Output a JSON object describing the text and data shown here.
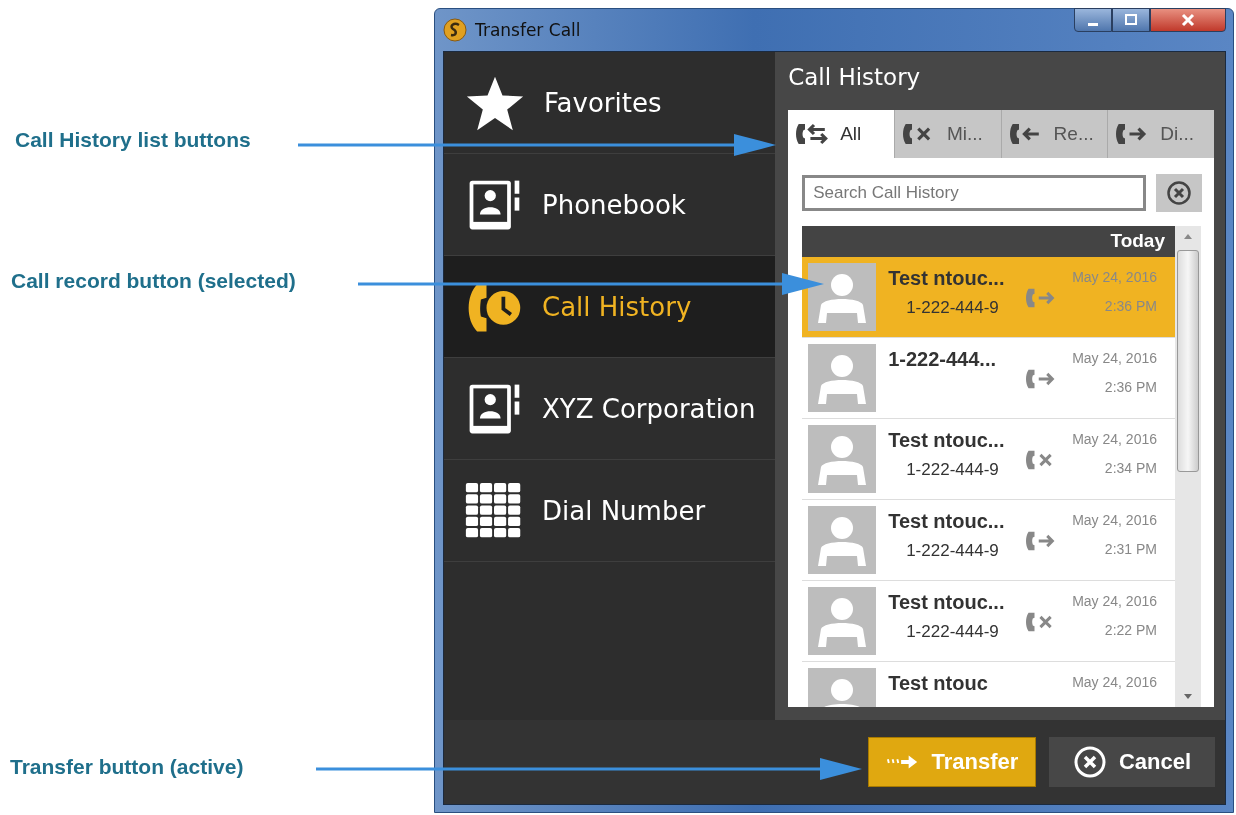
{
  "callouts": [
    {
      "text": "Call History list buttons",
      "kind": "tabs"
    },
    {
      "text": "Call record button (selected)",
      "kind": "record"
    },
    {
      "text": "Transfer button (active)",
      "kind": "transfer"
    }
  ],
  "window": {
    "title": "Transfer Call"
  },
  "nav": [
    {
      "label": "Favorites",
      "kind": "star",
      "selected": false
    },
    {
      "label": "Phonebook",
      "kind": "book",
      "selected": false
    },
    {
      "label": "Call History",
      "kind": "history",
      "selected": true
    },
    {
      "label": "XYZ Corporation",
      "kind": "book",
      "selected": false
    },
    {
      "label": "Dial Number",
      "kind": "keypad",
      "selected": false
    }
  ],
  "panel": {
    "title": "Call History",
    "tabs": [
      {
        "label": "All",
        "kind": "all",
        "selected": true
      },
      {
        "label": "Mi...",
        "kind": "missed",
        "selected": false
      },
      {
        "label": "Re...",
        "kind": "received",
        "selected": false
      },
      {
        "label": "Di...",
        "kind": "dialed",
        "selected": false
      }
    ],
    "search": {
      "placeholder": "Search Call History"
    },
    "group": "Today",
    "rows": [
      {
        "name": "Test ntouc...",
        "number": "1-222-444-9",
        "kind": "dialed",
        "date": "May 24, 2016",
        "time": "2:36 PM",
        "selected": true
      },
      {
        "name": "1-222-444...",
        "kind": "dialed",
        "date": "May 24, 2016",
        "time": "2:36 PM",
        "selected": false
      },
      {
        "name": "Test ntouc...",
        "number": "1-222-444-9",
        "kind": "missed",
        "date": "May 24, 2016",
        "time": "2:34 PM",
        "selected": false
      },
      {
        "name": "Test ntouc...",
        "number": "1-222-444-9",
        "kind": "dialed",
        "date": "May 24, 2016",
        "time": "2:31 PM",
        "selected": false
      },
      {
        "name": "Test ntouc...",
        "number": "1-222-444-9",
        "kind": "missed",
        "date": "May 24, 2016",
        "time": "2:22 PM",
        "selected": false
      },
      {
        "name": "Test ntouc",
        "kind": "none",
        "date": "May 24, 2016",
        "selected": false
      }
    ]
  },
  "buttons": {
    "transfer": {
      "label": "Transfer",
      "active": true
    },
    "cancel": {
      "label": "Cancel"
    }
  }
}
